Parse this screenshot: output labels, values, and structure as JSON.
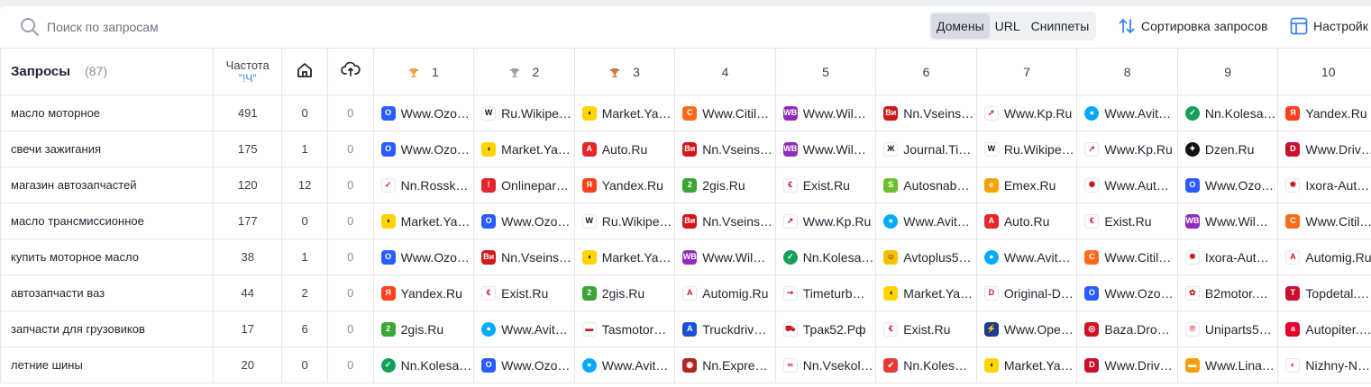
{
  "search": {
    "placeholder": "Поиск по запросам"
  },
  "view_tabs": [
    {
      "label": "Домены",
      "active": true
    },
    {
      "label": "URL",
      "active": false
    },
    {
      "label": "Сниппеты",
      "active": false
    }
  ],
  "sort_label": "Сортировка запросов",
  "settings_label": "Настройк",
  "colors": {
    "accent": "#3d82f0",
    "border": "#e2e5ea"
  },
  "header": {
    "queries_title": "Запросы",
    "queries_count": "(87)",
    "freq_title": "Частота",
    "freq_sub": "\"!Ч\"",
    "home_icon": "home-icon",
    "cloud_icon": "cloud-sync-icon",
    "positions": [
      "1",
      "2",
      "3",
      "4",
      "5",
      "6",
      "7",
      "8",
      "9",
      "10"
    ],
    "trophies": [
      {
        "pos": 1,
        "color": "#e8a23a"
      },
      {
        "pos": 2,
        "color": "#9aa0a6"
      },
      {
        "pos": 3,
        "color": "#c77a3b"
      }
    ]
  },
  "rows": [
    {
      "query": "масло моторное",
      "freq": "491",
      "home": "0",
      "cloud": "0",
      "domains": [
        {
          "name": "Www.Ozo…",
          "icon": "ozon",
          "color": "#2a5cff",
          "glyph": "O"
        },
        {
          "name": "Ru.Wikipe…",
          "icon": "wikipedia",
          "color": "#ffffff",
          "glyph": "W"
        },
        {
          "name": "Market.Ya…",
          "icon": "yandex-market",
          "color": "#ffd400",
          "glyph": "◖"
        },
        {
          "name": "Www.Citil…",
          "icon": "citilink",
          "color": "#ff6a1a",
          "glyph": "C"
        },
        {
          "name": "Www.Wil…",
          "icon": "wildberries",
          "color": "#8f2cb8",
          "glyph": "WB"
        },
        {
          "name": "Nn.Vseins…",
          "icon": "vseinstrumenti",
          "color": "#d01818",
          "glyph": "Ви"
        },
        {
          "name": "Www.Kp.Ru",
          "icon": "kp",
          "color": "#ffffff",
          "glyph": "➚"
        },
        {
          "name": "Www.Avit…",
          "icon": "avito",
          "color": "#00aaff",
          "glyph": "●"
        },
        {
          "name": "Nn.Kolesa…",
          "icon": "kolesa",
          "color": "#15a05a",
          "glyph": "✓"
        },
        {
          "name": "Yandex.Ru",
          "icon": "yandex",
          "color": "#fc3f1d",
          "glyph": "Я"
        }
      ]
    },
    {
      "query": "свечи зажигания",
      "freq": "175",
      "home": "1",
      "cloud": "0",
      "domains": [
        {
          "name": "Www.Ozo…",
          "icon": "ozon",
          "color": "#2a5cff",
          "glyph": "O"
        },
        {
          "name": "Market.Ya…",
          "icon": "yandex-market",
          "color": "#ffd400",
          "glyph": "◖"
        },
        {
          "name": "Auto.Ru",
          "icon": "auto-ru",
          "color": "#e8262a",
          "glyph": "A"
        },
        {
          "name": "Nn.Vseins…",
          "icon": "vseinstrumenti",
          "color": "#d01818",
          "glyph": "Ви"
        },
        {
          "name": "Www.Wil…",
          "icon": "wildberries",
          "color": "#8f2cb8",
          "glyph": "WB"
        },
        {
          "name": "Journal.Ti…",
          "icon": "journal",
          "color": "#ffffff",
          "glyph": "Ж"
        },
        {
          "name": "Ru.Wikipe…",
          "icon": "wikipedia",
          "color": "#ffffff",
          "glyph": "W"
        },
        {
          "name": "Www.Kp.Ru",
          "icon": "kp",
          "color": "#ffffff",
          "glyph": "➚"
        },
        {
          "name": "Dzen.Ru",
          "icon": "dzen",
          "color": "#111111",
          "glyph": "✦"
        },
        {
          "name": "Www.Driv…",
          "icon": "drive2",
          "color": "#c8102e",
          "glyph": "D"
        }
      ]
    },
    {
      "query": "магазин автозапчастей",
      "freq": "120",
      "home": "12",
      "cloud": "0",
      "domains": [
        {
          "name": "Nn.Rossk…",
          "icon": "rossko",
          "color": "#ffffff",
          "glyph": "✓"
        },
        {
          "name": "Onlinepar…",
          "icon": "onlineparts",
          "color": "#e3262b",
          "glyph": "!"
        },
        {
          "name": "Yandex.Ru",
          "icon": "yandex",
          "color": "#fc3f1d",
          "glyph": "Я"
        },
        {
          "name": "2gis.Ru",
          "icon": "2gis",
          "color": "#3aa635",
          "glyph": "2"
        },
        {
          "name": "Exist.Ru",
          "icon": "exist",
          "color": "#ffffff",
          "glyph": "€"
        },
        {
          "name": "Autosnab…",
          "icon": "autosnab",
          "color": "#6cbf2c",
          "glyph": "S"
        },
        {
          "name": "Emex.Ru",
          "icon": "emex",
          "color": "#f5a300",
          "glyph": "e"
        },
        {
          "name": "Www.Aut…",
          "icon": "autodoc",
          "color": "#ffffff",
          "glyph": "✺"
        },
        {
          "name": "Www.Ozo…",
          "icon": "ozon",
          "color": "#2a5cff",
          "glyph": "O"
        },
        {
          "name": "Ixora-Aut…",
          "icon": "ixora",
          "color": "#ffffff",
          "glyph": "✹"
        }
      ]
    },
    {
      "query": "масло трансмиссионное",
      "freq": "177",
      "home": "0",
      "cloud": "0",
      "domains": [
        {
          "name": "Market.Ya…",
          "icon": "yandex-market",
          "color": "#ffd400",
          "glyph": "◖"
        },
        {
          "name": "Www.Ozo…",
          "icon": "ozon",
          "color": "#2a5cff",
          "glyph": "O"
        },
        {
          "name": "Ru.Wikipe…",
          "icon": "wikipedia",
          "color": "#ffffff",
          "glyph": "W"
        },
        {
          "name": "Nn.Vseins…",
          "icon": "vseinstrumenti",
          "color": "#d01818",
          "glyph": "Ви"
        },
        {
          "name": "Www.Kp.Ru",
          "icon": "kp",
          "color": "#ffffff",
          "glyph": "➚"
        },
        {
          "name": "Www.Avit…",
          "icon": "avito",
          "color": "#00aaff",
          "glyph": "●"
        },
        {
          "name": "Auto.Ru",
          "icon": "auto-ru",
          "color": "#e8262a",
          "glyph": "A"
        },
        {
          "name": "Exist.Ru",
          "icon": "exist",
          "color": "#ffffff",
          "glyph": "€"
        },
        {
          "name": "Www.Wil…",
          "icon": "wildberries",
          "color": "#8f2cb8",
          "glyph": "WB"
        },
        {
          "name": "Www.Citil…",
          "icon": "citilink",
          "color": "#ff6a1a",
          "glyph": "C"
        }
      ]
    },
    {
      "query": "купить моторное масло",
      "freq": "38",
      "home": "1",
      "cloud": "0",
      "domains": [
        {
          "name": "Www.Ozo…",
          "icon": "ozon",
          "color": "#2a5cff",
          "glyph": "O"
        },
        {
          "name": "Nn.Vseins…",
          "icon": "vseinstrumenti",
          "color": "#d01818",
          "glyph": "Ви"
        },
        {
          "name": "Market.Ya…",
          "icon": "yandex-market",
          "color": "#ffd400",
          "glyph": "◖"
        },
        {
          "name": "Www.Wil…",
          "icon": "wildberries",
          "color": "#8f2cb8",
          "glyph": "WB"
        },
        {
          "name": "Nn.Kolesa…",
          "icon": "kolesa",
          "color": "#15a05a",
          "glyph": "✓"
        },
        {
          "name": "Avtoplus5…",
          "icon": "avtoplus",
          "color": "#f2c200",
          "glyph": "☺"
        },
        {
          "name": "Www.Avit…",
          "icon": "avito",
          "color": "#00aaff",
          "glyph": "●"
        },
        {
          "name": "Www.Citil…",
          "icon": "citilink",
          "color": "#ff6a1a",
          "glyph": "C"
        },
        {
          "name": "Ixora-Aut…",
          "icon": "ixora",
          "color": "#ffffff",
          "glyph": "✹"
        },
        {
          "name": "Automig.Ru",
          "icon": "automig",
          "color": "#ffffff",
          "glyph": "A"
        }
      ]
    },
    {
      "query": "автозапчасти ваз",
      "freq": "44",
      "home": "2",
      "cloud": "0",
      "domains": [
        {
          "name": "Yandex.Ru",
          "icon": "yandex",
          "color": "#fc3f1d",
          "glyph": "Я"
        },
        {
          "name": "Exist.Ru",
          "icon": "exist",
          "color": "#ffffff",
          "glyph": "€"
        },
        {
          "name": "2gis.Ru",
          "icon": "2gis",
          "color": "#3aa635",
          "glyph": "2"
        },
        {
          "name": "Automig.Ru",
          "icon": "automig",
          "color": "#ffffff",
          "glyph": "A"
        },
        {
          "name": "Timeturb…",
          "icon": "timeturbo",
          "color": "#ffffff",
          "glyph": "➙"
        },
        {
          "name": "Market.Ya…",
          "icon": "yandex-market",
          "color": "#ffd400",
          "glyph": "◖"
        },
        {
          "name": "Original-D…",
          "icon": "original-d",
          "color": "#ffffff",
          "glyph": "D"
        },
        {
          "name": "Www.Ozo…",
          "icon": "ozon",
          "color": "#2a5cff",
          "glyph": "O"
        },
        {
          "name": "B2motor.…",
          "icon": "b2motor",
          "color": "#ffffff",
          "glyph": "✿"
        },
        {
          "name": "Topdetal.…",
          "icon": "topdetal",
          "color": "#c8102e",
          "glyph": "T"
        }
      ]
    },
    {
      "query": "запчасти для грузовиков",
      "freq": "17",
      "home": "6",
      "cloud": "0",
      "domains": [
        {
          "name": "2gis.Ru",
          "icon": "2gis",
          "color": "#3aa635",
          "glyph": "2"
        },
        {
          "name": "Www.Avit…",
          "icon": "avito",
          "color": "#00aaff",
          "glyph": "●"
        },
        {
          "name": "Tasmotor…",
          "icon": "tasmotor",
          "color": "#ffffff",
          "glyph": "▬"
        },
        {
          "name": "Truckdriv…",
          "icon": "truckdrive",
          "color": "#1d4ed8",
          "glyph": "A"
        },
        {
          "name": "Трак52.Рф",
          "icon": "trak52",
          "color": "#ffffff",
          "glyph": "⛟"
        },
        {
          "name": "Exist.Ru",
          "icon": "exist",
          "color": "#ffffff",
          "glyph": "€"
        },
        {
          "name": "Www.Ope…",
          "icon": "opel",
          "color": "#1e3a8a",
          "glyph": "⚡"
        },
        {
          "name": "Baza.Dro…",
          "icon": "baza-drom",
          "color": "#d0141f",
          "glyph": "◎"
        },
        {
          "name": "Uniparts5…",
          "icon": "uniparts",
          "color": "#ffffff",
          "glyph": "℗"
        },
        {
          "name": "Autopiter.…",
          "icon": "autopiter",
          "color": "#e4002b",
          "glyph": "a"
        }
      ]
    },
    {
      "query": "летние шины",
      "freq": "20",
      "home": "0",
      "cloud": "0",
      "domains": [
        {
          "name": "Nn.Kolesa…",
          "icon": "kolesa",
          "color": "#15a05a",
          "glyph": "✓"
        },
        {
          "name": "Www.Ozo…",
          "icon": "ozon",
          "color": "#2a5cff",
          "glyph": "O"
        },
        {
          "name": "Www.Avit…",
          "icon": "avito",
          "color": "#00aaff",
          "glyph": "●"
        },
        {
          "name": "Nn.Expre…",
          "icon": "express-shina",
          "color": "#b3261e",
          "glyph": "◉"
        },
        {
          "name": "Nn.Vsekol…",
          "icon": "vsekolesa",
          "color": "#ffffff",
          "glyph": "∞"
        },
        {
          "name": "Nn.Koles…",
          "icon": "kolesa-darom",
          "color": "#e53935",
          "glyph": "➶"
        },
        {
          "name": "Market.Ya…",
          "icon": "yandex-market",
          "color": "#ffd400",
          "glyph": "◖"
        },
        {
          "name": "Www.Driv…",
          "icon": "drive2",
          "color": "#c8102e",
          "glyph": "D"
        },
        {
          "name": "Www.Lina…",
          "icon": "lina",
          "color": "#f59e0b",
          "glyph": "▬"
        },
        {
          "name": "Nizhny-N…",
          "icon": "nizhny",
          "color": "#ffffff",
          "glyph": "◐"
        }
      ]
    }
  ]
}
